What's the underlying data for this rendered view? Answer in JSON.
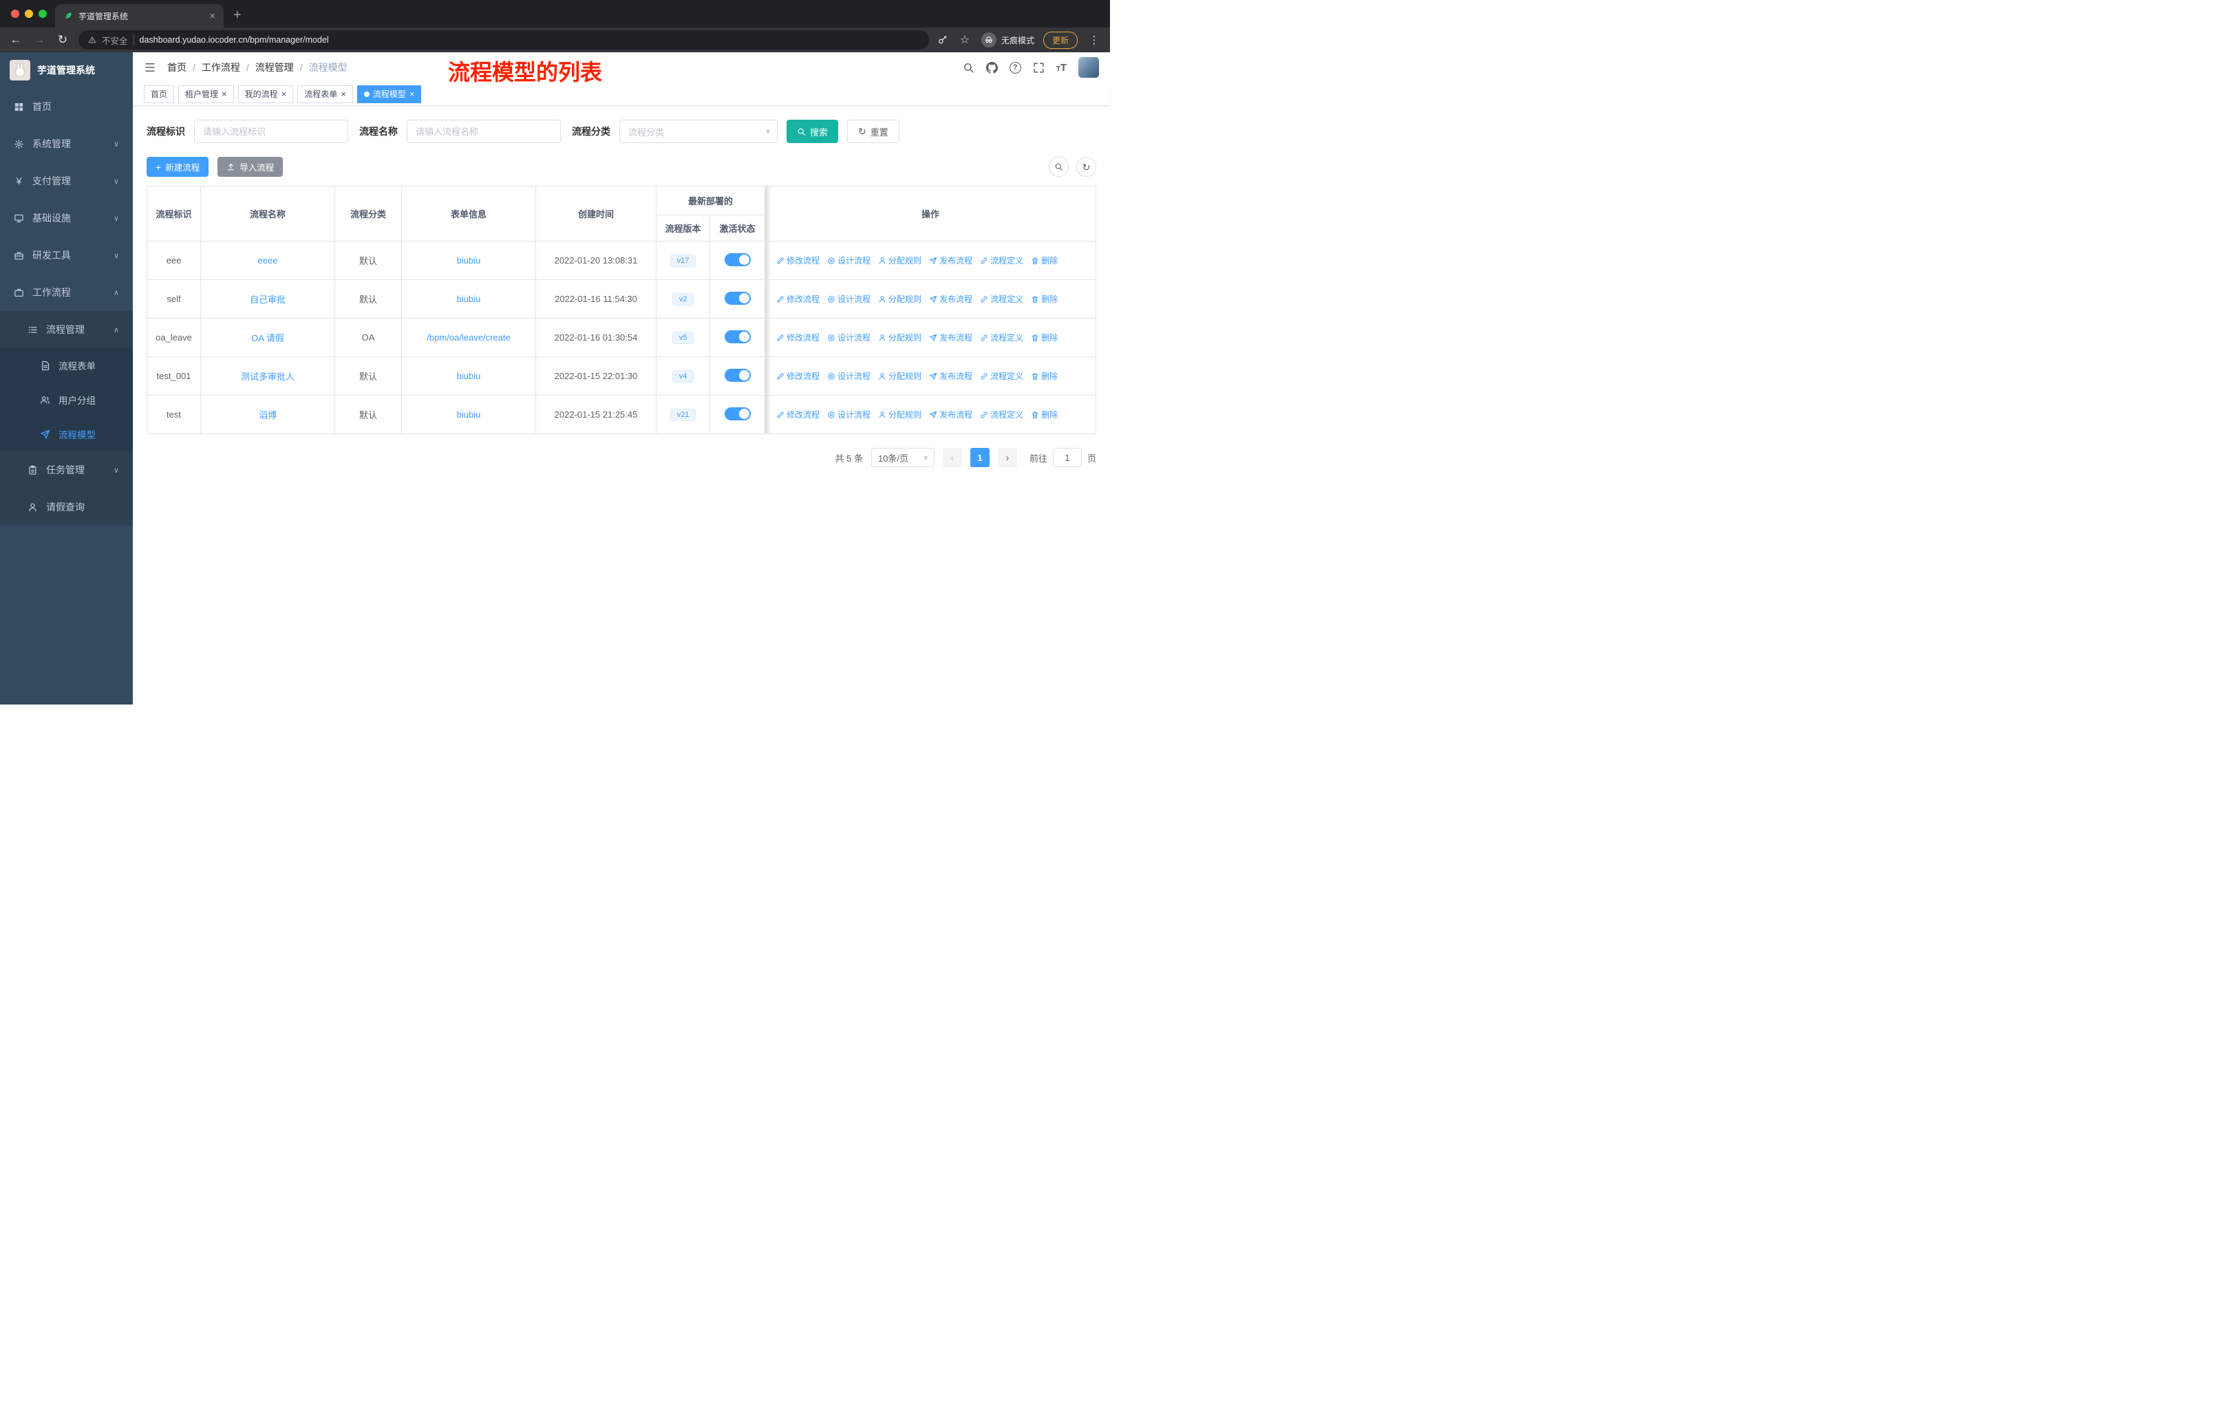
{
  "colors": {
    "primary": "#409eff",
    "search_button": "#18b3a3",
    "sidebar_bg": "#344a5f",
    "annotation_red": "#ff2000",
    "update_orange": "#e9a23b"
  },
  "glyphs": {
    "close": "×",
    "plus": "+",
    "back": "←",
    "forward": "→",
    "reload": "↻",
    "star": "☆",
    "overflow_menu": "⋮",
    "chevron_down": "∨",
    "chevron_up": "∧",
    "yen": "¥",
    "question": "?",
    "dropdown_arrow": "▾",
    "page_prev": "‹",
    "page_next": "›",
    "font_big": "T",
    "font_small": "T"
  },
  "browser": {
    "tab_title": "芋道管理系统",
    "security_label": "不安全",
    "url": "dashboard.yudao.iocoder.cn/bpm/manager/model",
    "incognito_label": "无痕模式",
    "update_label": "更新"
  },
  "sidebar": {
    "title": "芋道管理系统",
    "items": [
      {
        "label": "首页"
      },
      {
        "label": "系统管理"
      },
      {
        "label": "支付管理"
      },
      {
        "label": "基础设施"
      },
      {
        "label": "研发工具"
      },
      {
        "label": "工作流程"
      }
    ],
    "sub": {
      "process_mgmt": "流程管理",
      "children": [
        "流程表单",
        "用户分组",
        "流程模型"
      ],
      "task_mgmt": "任务管理",
      "leave_query": "请假查询"
    }
  },
  "header": {
    "breadcrumb": [
      "首页",
      "工作流程",
      "流程管理",
      "流程模型"
    ],
    "separator": "/",
    "annotation": "流程模型的列表"
  },
  "tabs": [
    {
      "label": "首页"
    },
    {
      "label": "租户管理"
    },
    {
      "label": "我的流程"
    },
    {
      "label": "流程表单"
    },
    {
      "label": "流程模型"
    }
  ],
  "filters": {
    "key_label": "流程标识",
    "key_placeholder": "请输入流程标识",
    "name_label": "流程名称",
    "name_placeholder": "请输入流程名称",
    "category_label": "流程分类",
    "category_placeholder": "流程分类",
    "search_label": "搜索",
    "reset_label": "重置"
  },
  "toolbar": {
    "create_label": "新建流程",
    "import_label": "导入流程"
  },
  "table": {
    "headers": {
      "key": "流程标识",
      "name": "流程名称",
      "category": "流程分类",
      "form": "表单信息",
      "created": "创建时间",
      "deploy_group": "最新部署的",
      "version": "流程版本",
      "state": "激活状态",
      "actions": "操作"
    },
    "actions": [
      "修改流程",
      "设计流程",
      "分配规则",
      "发布流程",
      "流程定义",
      "删除"
    ],
    "rows": [
      {
        "key": "eee",
        "name": "eeee",
        "category": "默认",
        "form": "biubiu",
        "created": "2022-01-20 13:08:31",
        "version": "v17"
      },
      {
        "key": "self",
        "name": "自己审批",
        "category": "默认",
        "form": "biubiu",
        "created": "2022-01-16 11:54:30",
        "version": "v2"
      },
      {
        "key": "oa_leave",
        "name": "OA 请假",
        "category": "OA",
        "form": "/bpm/oa/leave/create",
        "created": "2022-01-16 01:30:54",
        "version": "v5"
      },
      {
        "key": "test_001",
        "name": "测试多审批人",
        "category": "默认",
        "form": "biubiu",
        "created": "2022-01-15 22:01:30",
        "version": "v4"
      },
      {
        "key": "test",
        "name": "滔博",
        "category": "默认",
        "form": "biubiu",
        "created": "2022-01-15 21:25:45",
        "version": "v21"
      }
    ]
  },
  "pagination": {
    "total": "共 5 条",
    "page_size": "10条/页",
    "page": "1",
    "goto_label": "前往",
    "goto_value": "1",
    "unit_label": "页"
  }
}
